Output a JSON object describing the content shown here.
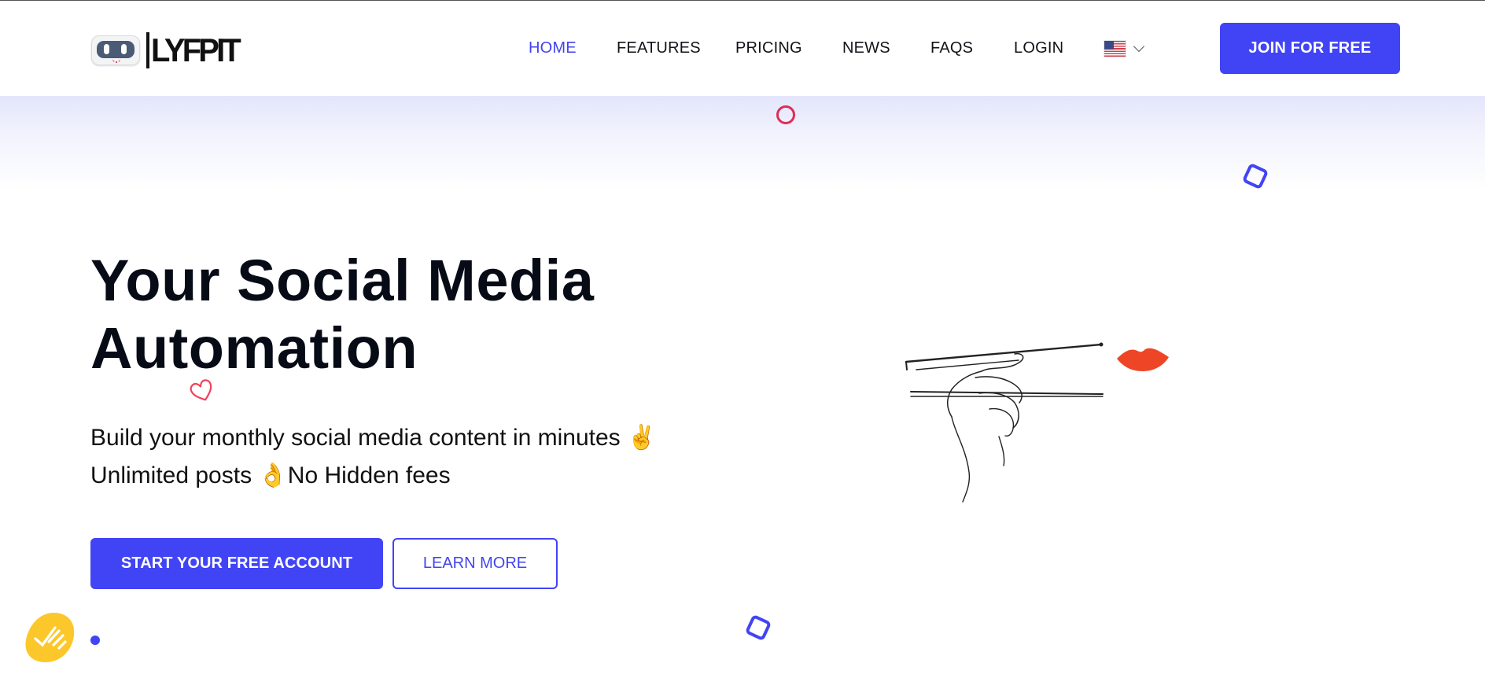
{
  "brand": {
    "name": "LYFPIT",
    "logo_icon": "robot-face-icon"
  },
  "nav": {
    "items": [
      {
        "label": "HOME",
        "active": true
      },
      {
        "label": "FEATURES",
        "active": false
      },
      {
        "label": "PRICING",
        "active": false
      },
      {
        "label": "NEWS",
        "active": false
      },
      {
        "label": "FAQS",
        "active": false
      },
      {
        "label": "LOGIN",
        "active": false
      }
    ],
    "language": {
      "selected": "en-US",
      "flag_icon": "us-flag-icon"
    },
    "cta_label": "JOIN FOR FREE"
  },
  "hero": {
    "title_line1": "Your Social Media",
    "title_line2": "Automation",
    "subtitle_line1": "Build your monthly social media content in minutes ✌️",
    "subtitle_line2_a": "Unlimited posts ",
    "subtitle_line2_emoji": "👌",
    "subtitle_line2_b": "No Hidden fees",
    "primary_button": "START YOUR FREE ACCOUNT",
    "secondary_button": "LEARN MORE"
  },
  "illustration": {
    "subject": "hand-with-chopsticks-and-lips"
  },
  "colors": {
    "accent": "#4144f5",
    "active_nav": "#4144ee",
    "decor_red": "#e02c5a",
    "lips": "#ee4526",
    "badge": "#fcc72a",
    "text": "#070b16"
  }
}
